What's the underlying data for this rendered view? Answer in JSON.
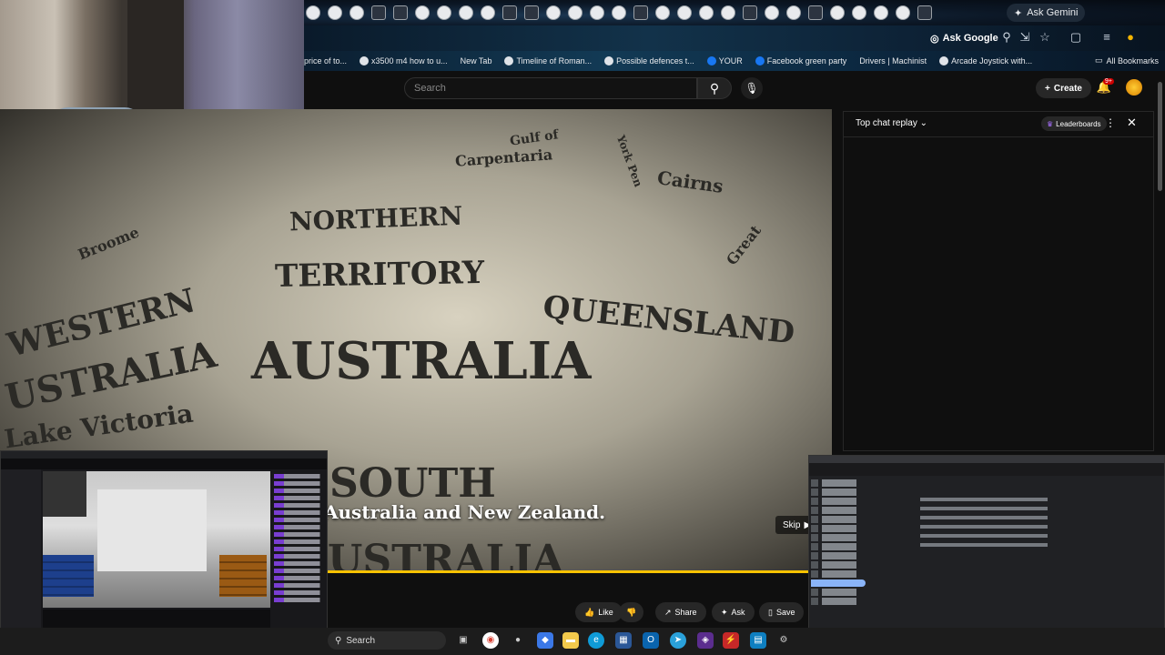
{
  "browser": {
    "ask_gemini": "Ask Gemini",
    "ask_google": "Ask Google",
    "bookmarks": [
      {
        "label": "price of to..."
      },
      {
        "label": "x3500 m4 how to u..."
      },
      {
        "label": "New Tab"
      },
      {
        "label": "Timeline of Roman..."
      },
      {
        "label": "Possible defences t..."
      },
      {
        "label": "YOUR"
      },
      {
        "label": "Facebook green party"
      },
      {
        "label": "Drivers | Machinist"
      },
      {
        "label": "Arcade Joystick with..."
      }
    ],
    "all_bookmarks": "All Bookmarks"
  },
  "youtube": {
    "search_placeholder": "Search",
    "create_label": "Create",
    "notification_count": "9+",
    "video": {
      "caption": "Australia and New Zealand.",
      "skip_label": "Skip",
      "map_labels": {
        "gulf": "Gulf of",
        "carpentaria": "Carpentaria",
        "york": "York Pen",
        "cairns": "Cairns",
        "great": "Great",
        "broome": "Broome",
        "northern": "NORTHERN",
        "territory": "TERRITORY",
        "queensland": "QUEENSLAND",
        "western": "WESTERN",
        "australia_w": "USTRALIA",
        "australia": "AUSTRALIA",
        "lake_victoria": "Lake Victoria",
        "south": "SOUTH",
        "australia_s": "USTRALIA"
      }
    },
    "chat": {
      "title": "Top chat replay",
      "leaderboards": "Leaderboards"
    },
    "actions": {
      "like": "Like",
      "share": "Share",
      "ask": "Ask",
      "save": "Save"
    }
  },
  "taskbar": {
    "search_placeholder": "Search"
  },
  "colors": {
    "progress": "#f7c200",
    "youtube_bg": "#0f0f0f",
    "accent_blue": "#8ab4f8"
  }
}
